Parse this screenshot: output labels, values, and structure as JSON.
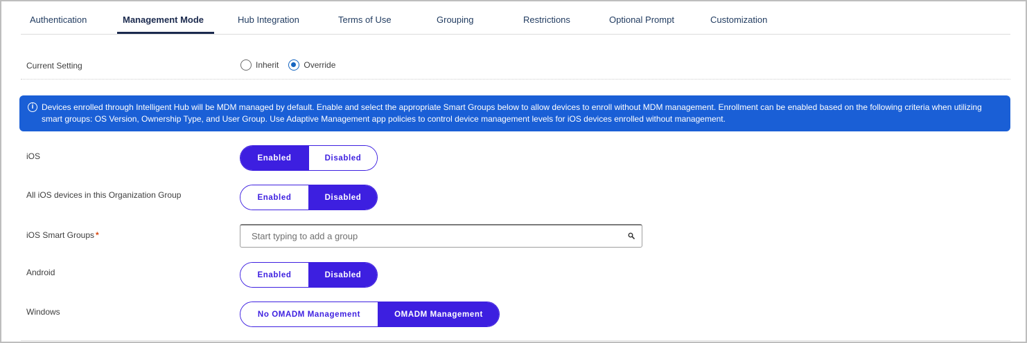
{
  "tabs": [
    {
      "label": "Authentication",
      "active": false
    },
    {
      "label": "Management Mode",
      "active": true
    },
    {
      "label": "Hub Integration",
      "active": false
    },
    {
      "label": "Terms of Use",
      "active": false
    },
    {
      "label": "Grouping",
      "active": false
    },
    {
      "label": "Restrictions",
      "active": false
    },
    {
      "label": "Optional Prompt",
      "active": false
    },
    {
      "label": "Customization",
      "active": false
    }
  ],
  "current_setting": {
    "label": "Current Setting",
    "options": [
      {
        "label": "Inherit",
        "checked": false
      },
      {
        "label": "Override",
        "checked": true
      }
    ]
  },
  "banner": {
    "text": "Devices enrolled through Intelligent Hub will be MDM managed by default. Enable and select the appropriate Smart Groups below to allow devices to enroll without MDM management. Enrollment can be enabled based on the following criteria when utilizing smart groups: OS Version, Ownership Type, and User Group. Use Adaptive Management app policies to control device management levels for iOS devices enrolled without management.",
    "color": "#1a5fd6"
  },
  "ios": {
    "label": "iOS",
    "enabled_label": "Enabled",
    "disabled_label": "Disabled",
    "selected": "enabled"
  },
  "all_ios": {
    "label": "All iOS devices in this Organization Group",
    "enabled_label": "Enabled",
    "disabled_label": "Disabled",
    "selected": "disabled"
  },
  "ios_smart_groups": {
    "label": "iOS Smart Groups",
    "required_mark": "*",
    "placeholder": "Start typing to add a group",
    "value": ""
  },
  "android": {
    "label": "Android",
    "enabled_label": "Enabled",
    "disabled_label": "Disabled",
    "selected": "disabled"
  },
  "windows": {
    "label": "Windows",
    "no_omadm_label": "No OMADM Management",
    "omadm_label": "OMADM Management",
    "selected": "omadm"
  },
  "colors": {
    "accent": "#3d1fe0",
    "radio": "#1565c0",
    "required": "#d9480f"
  }
}
